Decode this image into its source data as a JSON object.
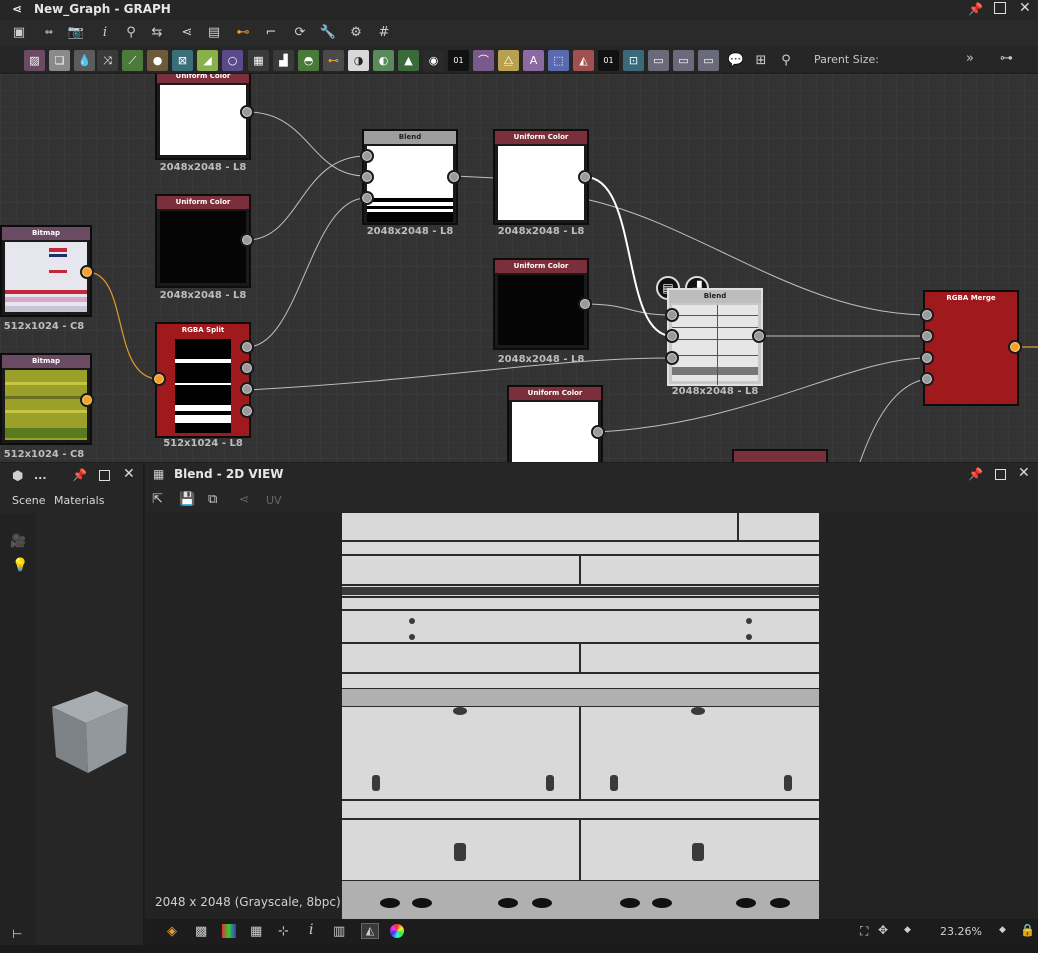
{
  "graph": {
    "title": "New_Graph - GRAPH",
    "parent_size_label": "Parent Size:",
    "nodes": {
      "uc1": {
        "title": "Uniform Color",
        "label": "2048x2048 - L8"
      },
      "uc2": {
        "title": "Uniform Color",
        "label": "2048x2048 - L8"
      },
      "blend1": {
        "title": "Blend",
        "label": "2048x2048 - L8"
      },
      "uc3": {
        "title": "Uniform Color",
        "label": "2048x2048 - L8"
      },
      "uc4": {
        "title": "Uniform Color",
        "label": "2048x2048 - L8"
      },
      "bitmap1": {
        "title": "Bitmap",
        "label": "512x1024 - C8"
      },
      "bitmap2": {
        "title": "Bitmap",
        "label": "512x1024 - C8"
      },
      "split": {
        "title": "RGBA Split",
        "label": "512x1024 - L8"
      },
      "blend2": {
        "title": "Blend",
        "label": "2048x2048 - L8"
      },
      "uc5": {
        "title": "Uniform Color"
      },
      "merge": {
        "title": "RGBA Merge"
      }
    }
  },
  "side": {
    "title": "...",
    "tab_scene": "Scene",
    "tab_materials": "Materials"
  },
  "view": {
    "title": "Blend - 2D VIEW",
    "uv_label": "UV",
    "info": "2048 x 2048 (Grayscale, 8bpc)",
    "zoom": "23.26%"
  },
  "colors": {
    "node_header_red": "#7a2f3b",
    "bitmap_header": "#6b4a63",
    "split_red": "#a01a1d",
    "accent_orange": "#f2a22a"
  }
}
